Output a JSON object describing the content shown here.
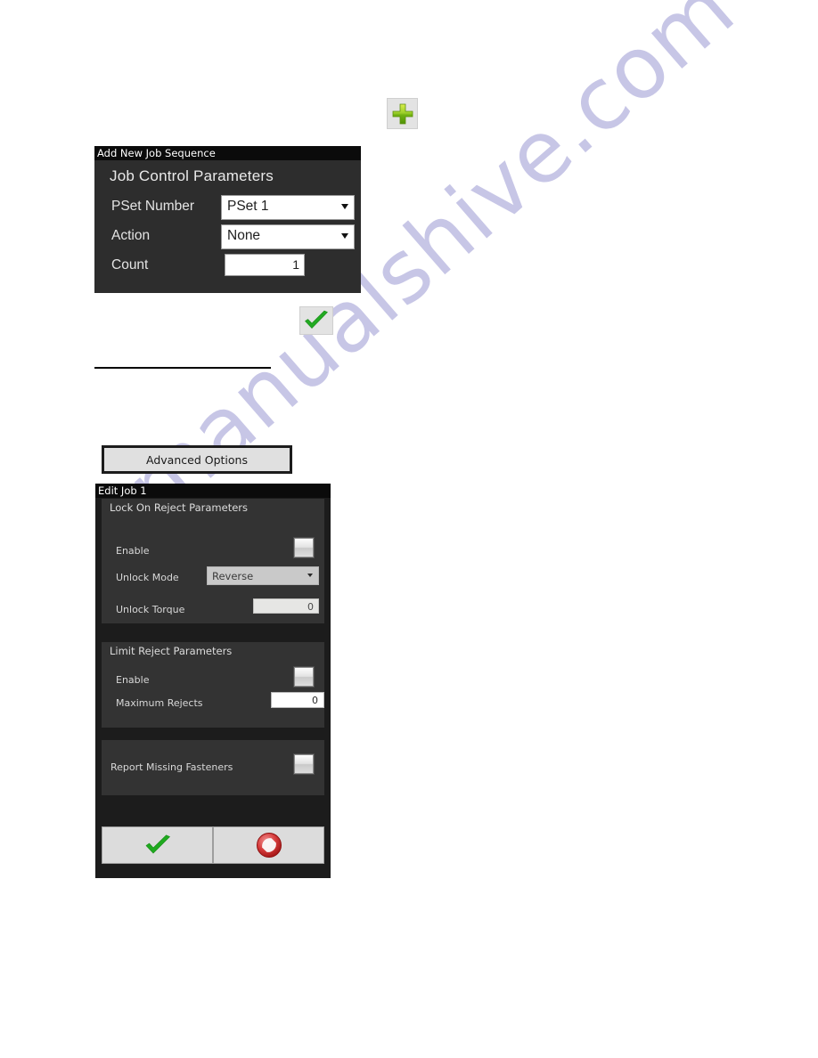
{
  "page": {
    "watermark_text": "manualshive.com",
    "watermark_color": "#3a36a8",
    "background_color": "#ffffff"
  },
  "toolbar": {
    "add_button": {
      "icon": "plus-icon",
      "tooltip": "Add"
    },
    "confirm_button": {
      "icon": "green-check-icon",
      "tooltip": "Confirm"
    }
  },
  "advanced_options_button": {
    "label": "Advanced Options"
  },
  "add_job_dialog": {
    "title": "Add New Job Sequence",
    "section_heading": "Job Control Parameters",
    "fields": [
      {
        "label": "PSet Number",
        "type": "dropdown",
        "value": "PSet 1"
      },
      {
        "label": "Action",
        "type": "dropdown",
        "value": "None"
      },
      {
        "label": "Count",
        "type": "number",
        "value": "1"
      }
    ]
  },
  "edit_job_dialog": {
    "title": "Edit Job 1",
    "sections": [
      {
        "heading": "Lock On Reject Parameters",
        "fields": [
          {
            "label": "Enable",
            "type": "checkbox",
            "checked": false
          },
          {
            "label": "Unlock Mode",
            "type": "dropdown",
            "value": "Reverse"
          },
          {
            "label": "Unlock Torque",
            "type": "number",
            "value": "0"
          }
        ]
      },
      {
        "heading": "Limit Reject Parameters",
        "fields": [
          {
            "label": "Enable",
            "type": "checkbox",
            "checked": false
          },
          {
            "label": "Maximum Rejects",
            "type": "number",
            "value": "0"
          }
        ]
      },
      {
        "heading": "",
        "fields": [
          {
            "label": "Report Missing Fasteners",
            "type": "checkbox",
            "checked": false
          }
        ]
      }
    ],
    "footer": {
      "accept": {
        "icon": "green-check-icon"
      },
      "cancel": {
        "icon": "red-deny-icon"
      }
    }
  },
  "colors": {
    "panel_dark": "#2d2d2d",
    "panel_darker": "#1c1c1c",
    "card_gray": "#333333",
    "title_bar": "#0b0b0b",
    "accent_green": "#2ea02e",
    "accent_red": "#c22a2a",
    "button_face": "#e0e0e0"
  }
}
